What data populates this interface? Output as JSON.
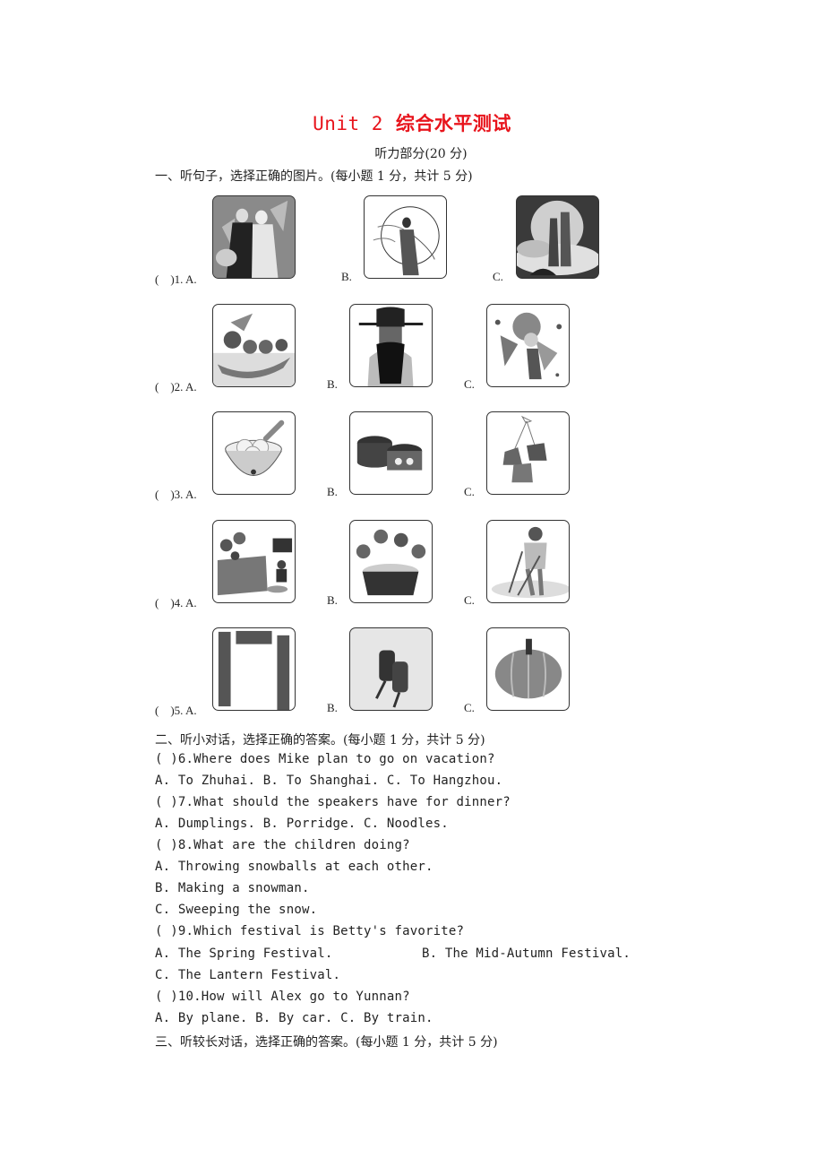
{
  "header": {
    "title_en": "Unit 2",
    "title_zh": "综合水平测试",
    "subtitle": "听力部分(20 分)"
  },
  "section1": {
    "heading": "一、听句子，选择正确的图片。(每小题 1 分，共计 5 分)",
    "questions": [
      {
        "label": "(　)1. A.",
        "b": "B.",
        "c": "C.",
        "images": [
          "chang-e-couple-opera-image",
          "chang-e-moon-image",
          "cowherd-weaver-girl-image"
        ]
      },
      {
        "label": "(　)2. A.",
        "b": "B.",
        "c": "C.",
        "images": [
          "dragon-boat-race-image",
          "opera-mask-figure-image",
          "lion-dance-image"
        ]
      },
      {
        "label": "(　)3. A.",
        "b": "B.",
        "c": "C.",
        "images": [
          "tangyuan-bowl-image",
          "mooncakes-image",
          "zongzi-image"
        ]
      },
      {
        "label": "(　)4. A.",
        "b": "B.",
        "c": "C.",
        "images": [
          "family-watching-tv-image",
          "family-dinner-image",
          "man-sweeping-image"
        ]
      },
      {
        "label": "(　)5. A.",
        "b": "B.",
        "c": "C.",
        "images": [
          "spring-couplets-image",
          "firecrackers-image",
          "pumpkin-image"
        ]
      }
    ]
  },
  "section2": {
    "heading": "二、听小对话，选择正确的答案。(每小题 1 分，共计 5 分)",
    "lines": [
      "(  )6.Where does Mike plan to go on vacation?",
      "A. To Zhuhai.    B. To Shanghai.    C. To Hangzhou.",
      "(  )7.What should the speakers have for dinner?",
      "A. Dumplings.    B. Porridge.    C. Noodles.",
      "(  )8.What are the children doing?",
      "A. Throwing snowballs at each other.",
      "B. Making a snowman.",
      "C. Sweeping the snow.",
      "(  )9.Which festival is Betty's favorite?",
      "A. The Spring Festival.",
      "C. The Lantern Festival.",
      "(  )10.How will Alex go to Yunnan?",
      "A. By plane.    B. By car.    C. By train."
    ],
    "q9_option_b": "B. The Mid-Autumn Festival."
  },
  "section3": {
    "heading": "三、听较长对话，选择正确的答案。(每小题 1 分，共计 5 分)"
  }
}
